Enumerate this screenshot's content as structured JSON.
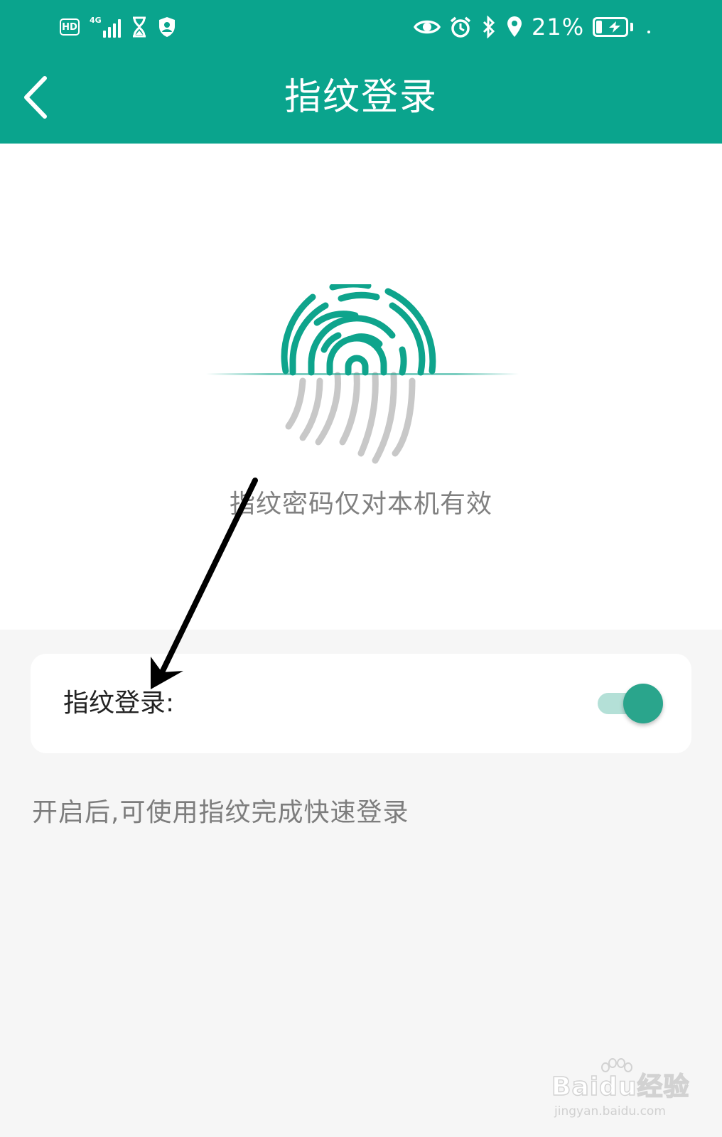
{
  "status_bar": {
    "hd_badge": "HD",
    "network": "4G",
    "battery_percent": "21%",
    "battery_level": 0.21,
    "charging": true,
    "left_icons": [
      "hd-icon",
      "signal-icon",
      "hourglass-icon",
      "shield-user-icon"
    ],
    "right_icons": [
      "eye-icon",
      "alarm-icon",
      "bluetooth-icon",
      "location-icon",
      "battery-icon"
    ]
  },
  "header": {
    "title": "指纹登录",
    "back_icon": "chevron-left-icon"
  },
  "hero": {
    "note": "指纹密码仅对本机有效",
    "illustration": "fingerprint-icon"
  },
  "setting": {
    "label": "指纹登录:",
    "enabled": true
  },
  "hint": "开启后,可使用指纹完成快速登录",
  "watermark": {
    "main": "Bai",
    "paw": "du",
    "suffix": "经验",
    "sub": "jingyan.baidu.com"
  },
  "colors": {
    "header": "#0aa48d",
    "toggle_thumb": "#2aa58c",
    "toggle_track": "#b4e0d7",
    "page_bg": "#f6f6f6",
    "fingerprint_green": "#0ea48c",
    "fingerprint_gray": "#c8c8c8"
  }
}
